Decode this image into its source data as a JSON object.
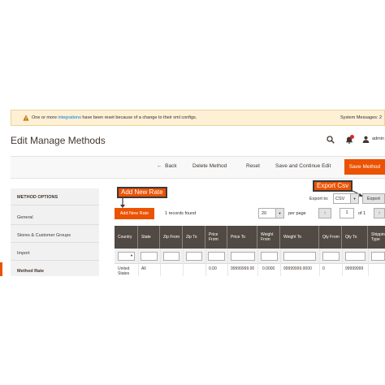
{
  "system_message": {
    "text_before": "One or more",
    "link": "integrations",
    "text_after": "have been reset because of a change to their xml configs.",
    "system_messages": "System Messages: 2"
  },
  "header": {
    "title": "Edit Manage Methods",
    "user": "admin",
    "notifications_color": "#e22626"
  },
  "actions": {
    "back": "Back",
    "delete": "Delete Method",
    "reset": "Reset",
    "save_continue": "Save and Continue Edit",
    "save": "Save Method"
  },
  "sidebar": {
    "title": "METHOD OPTIONS",
    "items": [
      {
        "label": "General"
      },
      {
        "label": "Stores & Customer Groups"
      },
      {
        "label": "Import"
      },
      {
        "label": "Method Rate"
      }
    ]
  },
  "callouts": {
    "add_new_rate": "Add New Rate",
    "export_csv": "Export Csv"
  },
  "grid_toolbar": {
    "add_button": "Add New Rate",
    "records": "1 records found",
    "per_page_value": "20",
    "per_page_label": "per page",
    "prev": "‹",
    "page": "1",
    "of": "of 1",
    "next": "›",
    "export_label": "Export to:",
    "export_format": "CSV",
    "export_button": "Export"
  },
  "table": {
    "headers": [
      "Country",
      "State",
      "Zip From",
      "Zip To",
      "Price From",
      "Price To",
      "Weight From",
      "Weight To",
      "Qty From",
      "Qty To",
      "Shipping Type"
    ],
    "rows": [
      [
        "United States",
        "All",
        "",
        "",
        "0.00",
        "99999999.00",
        "0.0000",
        "99999999.0000",
        "0",
        "99999999",
        ""
      ]
    ]
  },
  "colors": {
    "accent": "#eb5202",
    "grid_header": "#514943",
    "message_bg": "#fdf0d5"
  }
}
